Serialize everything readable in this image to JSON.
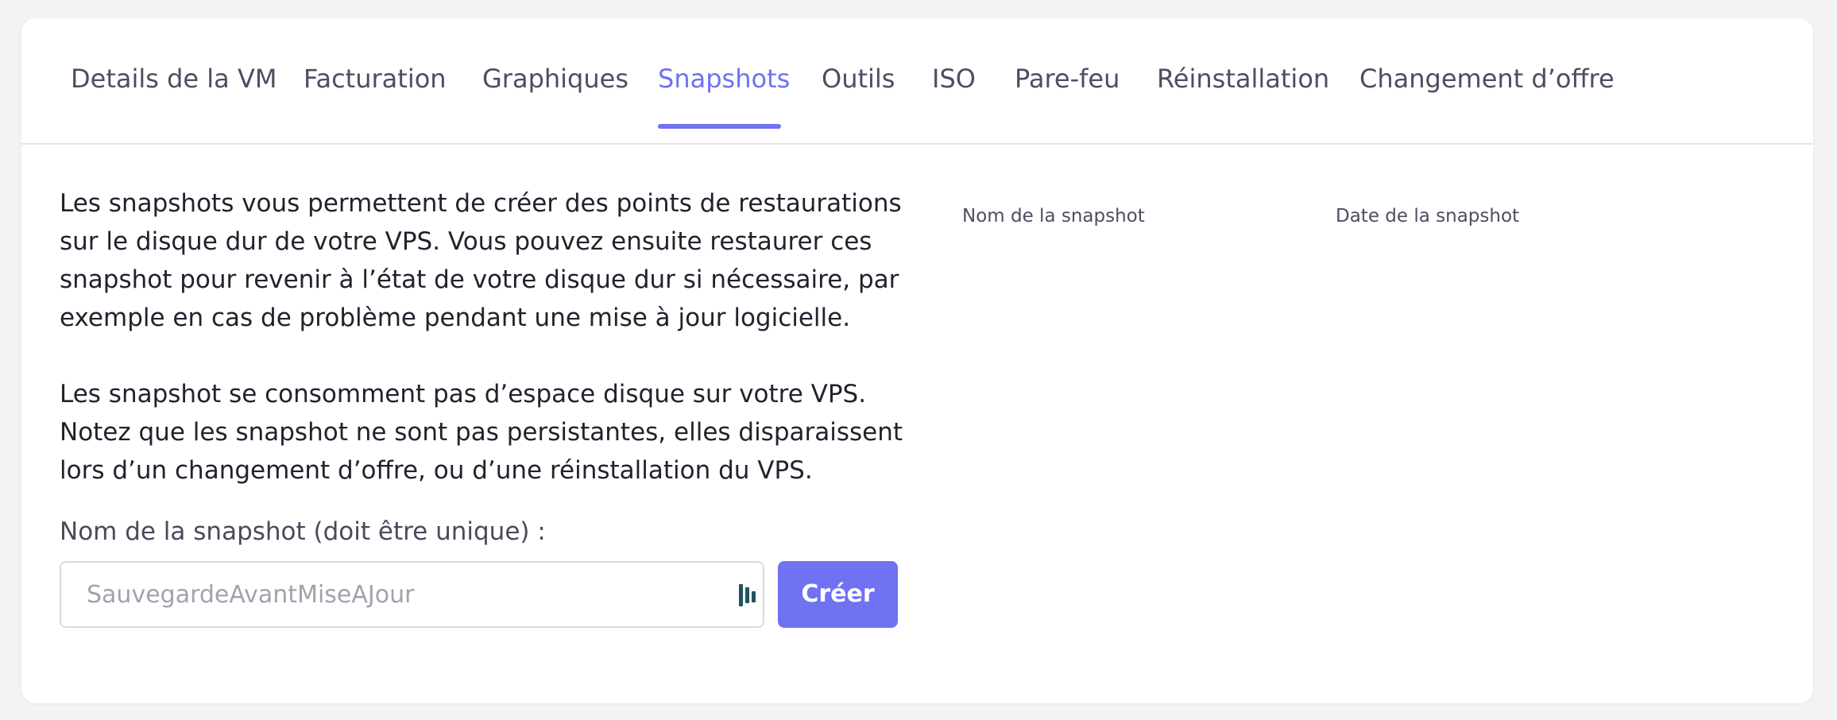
{
  "tabs": [
    {
      "label": "Details de la VM"
    },
    {
      "label": "Facturation"
    },
    {
      "label": "Graphiques"
    },
    {
      "label": "Snapshots",
      "active": true
    },
    {
      "label": "Outils"
    },
    {
      "label": "ISO"
    },
    {
      "label": "Pare-feu"
    },
    {
      "label": "Réinstallation"
    },
    {
      "label": "Changement d’offre"
    }
  ],
  "content": {
    "paragraph1": "Les snapshots vous permettent de créer des points de restaurations sur le disque dur de votre VPS. Vous pouvez ensuite restaurer ces snapshot pour revenir à l’état de votre disque dur si nécessaire, par exemple en cas de problème pendant une mise à jour logicielle.",
    "paragraph2": "Les snapshot se consomment pas d’espace disque sur votre VPS. Notez que les snapshot ne sont pas persistantes, elles disparaissent lors d’un changement d’offre, ou d’une réinstallation du VPS.",
    "field_label": "Nom de la snapshot (doit être unique) :",
    "input_value": "",
    "input_placeholder": "SauvegardeAvantMiseAJour",
    "create_button": "Créer"
  },
  "table": {
    "columns": [
      "Nom de la snapshot",
      "Date de la snapshot"
    ]
  },
  "icons": {
    "input_trailing": "password-manager-icon"
  },
  "colors": {
    "accent": "#6f72f2",
    "text": "#22222e",
    "muted": "#4d4d63",
    "background": "#f3f3f5",
    "card": "#ffffff",
    "icon": "#1f5560"
  }
}
